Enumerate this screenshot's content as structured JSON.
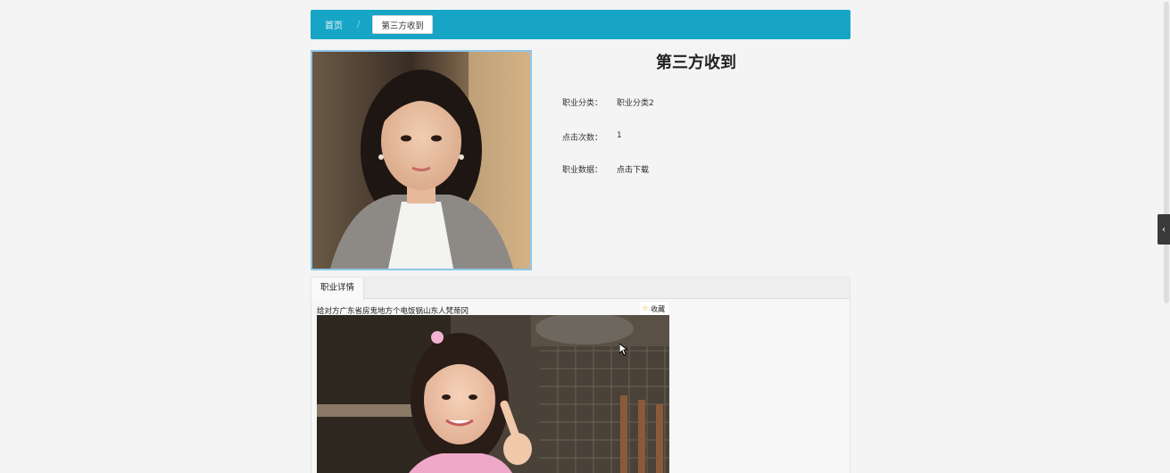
{
  "breadcrumb": {
    "home": "首页",
    "separator": "/",
    "current": "第三方收到"
  },
  "detail": {
    "title": "第三方收到",
    "rows": [
      {
        "label": "职业分类：",
        "value": "职业分类2"
      },
      {
        "label": "点击次数：",
        "value": "1"
      },
      {
        "label": "职业数据：",
        "value": "点击下载"
      }
    ]
  },
  "tabs": [
    {
      "label": "职业详情"
    }
  ],
  "content": {
    "text": "给对方广东省房鬼地方个电饭锅山东人梵蒂冈",
    "favorite_label": "收藏"
  },
  "icons": {
    "star": "star-icon",
    "side_toggle": "chevron-left-icon",
    "cursor": "mouse-pointer-icon"
  },
  "colors": {
    "header_bar": "#17a5c6",
    "photo_border": "#8ec7e8",
    "star": "#f0a020"
  }
}
